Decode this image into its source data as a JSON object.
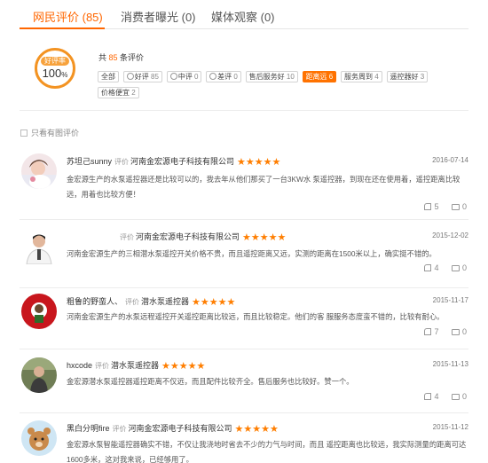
{
  "tabs": [
    {
      "label": "网民评价 (85)"
    },
    {
      "label": "消费者曝光 (0)"
    },
    {
      "label": "媒体观察 (0)"
    }
  ],
  "summary": {
    "rate_label": "好评率",
    "rate_value": "100",
    "rate_unit": "%",
    "total_prefix": "共 ",
    "total_count": "85",
    "total_suffix": " 条评价"
  },
  "tags": [
    {
      "label": "全部",
      "count": "",
      "icon": ""
    },
    {
      "label": "好评",
      "count": "85",
      "icon": "smile-icon"
    },
    {
      "label": "中评",
      "count": "0",
      "icon": "neutral-icon"
    },
    {
      "label": "差评",
      "count": "0",
      "icon": "frown-icon"
    },
    {
      "label": "售后服务好",
      "count": "10",
      "icon": ""
    },
    {
      "label": "距离远",
      "count": "6",
      "icon": ""
    },
    {
      "label": "服务周到",
      "count": "4",
      "icon": ""
    },
    {
      "label": "遥控器好",
      "count": "3",
      "icon": ""
    },
    {
      "label": "价格便宜",
      "count": "2",
      "icon": ""
    }
  ],
  "filter": {
    "label": "只看有图评价"
  },
  "say_label": "评价",
  "stars_text": "★★★★★",
  "reviews": [
    {
      "user": "苏坦己sunny",
      "company": "河南金宏源电子科技有限公司",
      "date": "2016-07-14",
      "text": "金宏源生产的水泵遥控器还是比较可以的，我去年从他们那买了一台3KW水 泵遥控器，到现在还在使用着，遥控距离比较远，用着也比较方便！",
      "likes": "5",
      "comments": "0"
    },
    {
      "user": "",
      "company": "河南金宏源电子科技有限公司",
      "date": "2015-12-02",
      "text": "河南金宏源生产的三相潜水泵遥控开关价格不贵，而且遥控距离又远，实测的距离在1500米以上，确实挺不错的。",
      "likes": "4",
      "comments": "0"
    },
    {
      "user": "粗鲁的野蛮人、",
      "company": "潜水泵遥控器",
      "date": "2015-11-17",
      "text": "河南金宏源生产的水泵远程遥控开关遥控距离比较远，而且比较稳定。他们的客 服服务态度蛮不错的，比较有耐心。",
      "likes": "7",
      "comments": "0"
    },
    {
      "user": "hxcode",
      "company": "潜水泵遥控器",
      "date": "2015-11-13",
      "text": "金宏源潜水泵遥控器遥控距离不仅远，而且配件比较齐全。售后服务也比较好。赞一个。",
      "likes": "4",
      "comments": "0"
    },
    {
      "user": "黑白分明fire",
      "company": "河南金宏源电子科技有限公司",
      "date": "2015-11-12",
      "text": "金宏源水泵智能遥控器确实不错，不仅让我浇地时省去不少的力气与时间，而且 遥控距离也比较远，我实际测量的距离可达1600多米，这对我来说，已经够用了。",
      "likes": "",
      "comments": ""
    }
  ],
  "colors": {
    "accent": "#ff6600",
    "stars": "#ff7e00",
    "ring": "#f39322"
  }
}
